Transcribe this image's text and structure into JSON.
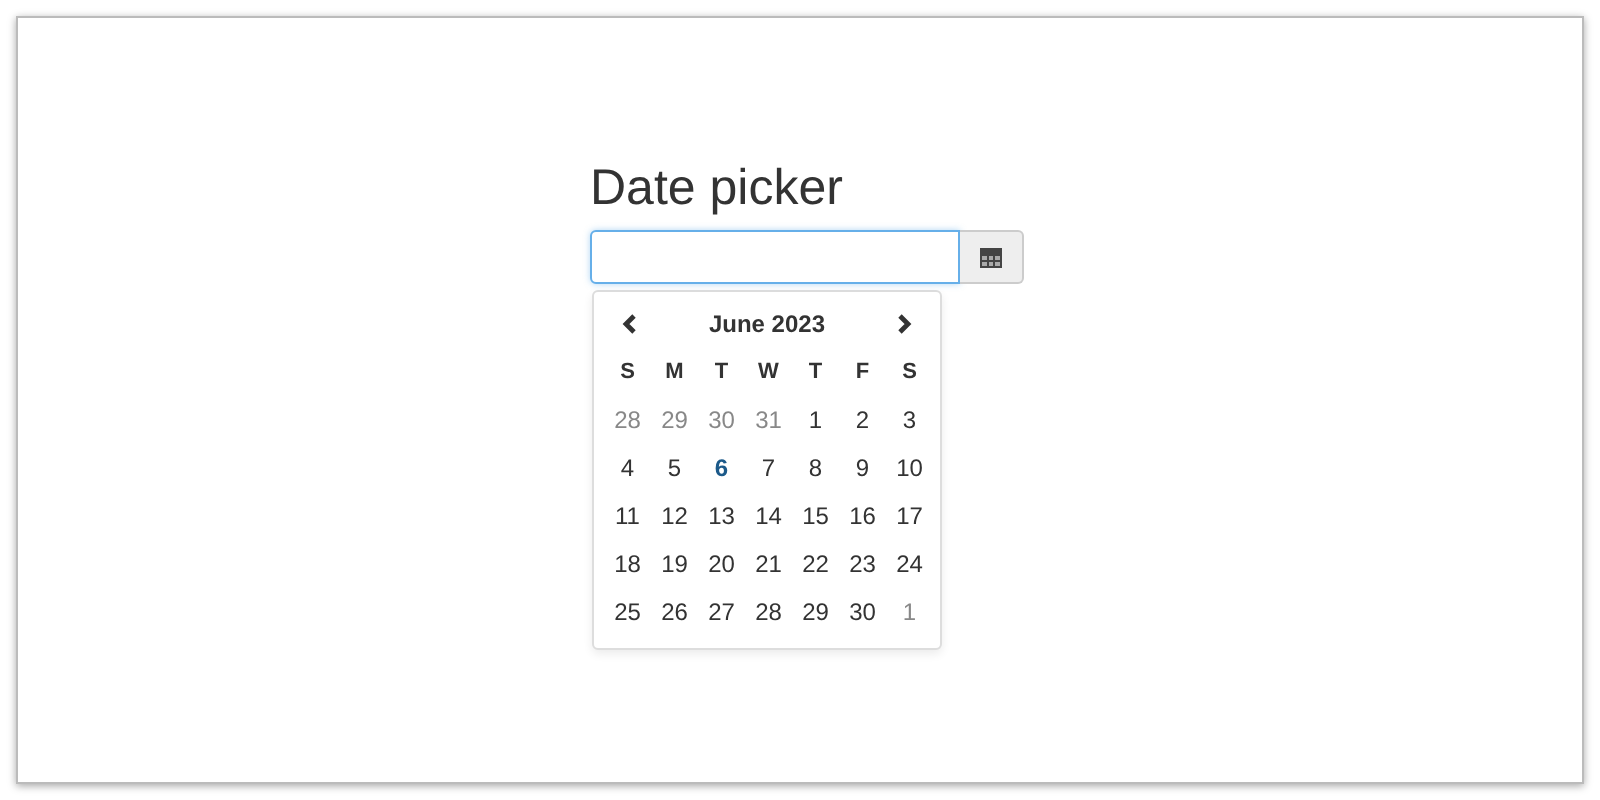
{
  "title": "Date picker",
  "input": {
    "focused": true
  },
  "calendar": {
    "month_label": "June 2023",
    "weekdays": [
      "S",
      "M",
      "T",
      "W",
      "T",
      "F",
      "S"
    ],
    "weeks": [
      [
        {
          "day": "28",
          "other_month": true,
          "today": false
        },
        {
          "day": "29",
          "other_month": true,
          "today": false
        },
        {
          "day": "30",
          "other_month": true,
          "today": false
        },
        {
          "day": "31",
          "other_month": true,
          "today": false
        },
        {
          "day": "1",
          "other_month": false,
          "today": false
        },
        {
          "day": "2",
          "other_month": false,
          "today": false
        },
        {
          "day": "3",
          "other_month": false,
          "today": false
        }
      ],
      [
        {
          "day": "4",
          "other_month": false,
          "today": false
        },
        {
          "day": "5",
          "other_month": false,
          "today": false
        },
        {
          "day": "6",
          "other_month": false,
          "today": true
        },
        {
          "day": "7",
          "other_month": false,
          "today": false
        },
        {
          "day": "8",
          "other_month": false,
          "today": false
        },
        {
          "day": "9",
          "other_month": false,
          "today": false
        },
        {
          "day": "10",
          "other_month": false,
          "today": false
        }
      ],
      [
        {
          "day": "11",
          "other_month": false,
          "today": false
        },
        {
          "day": "12",
          "other_month": false,
          "today": false
        },
        {
          "day": "13",
          "other_month": false,
          "today": false
        },
        {
          "day": "14",
          "other_month": false,
          "today": false
        },
        {
          "day": "15",
          "other_month": false,
          "today": false
        },
        {
          "day": "16",
          "other_month": false,
          "today": false
        },
        {
          "day": "17",
          "other_month": false,
          "today": false
        }
      ],
      [
        {
          "day": "18",
          "other_month": false,
          "today": false
        },
        {
          "day": "19",
          "other_month": false,
          "today": false
        },
        {
          "day": "20",
          "other_month": false,
          "today": false
        },
        {
          "day": "21",
          "other_month": false,
          "today": false
        },
        {
          "day": "22",
          "other_month": false,
          "today": false
        },
        {
          "day": "23",
          "other_month": false,
          "today": false
        },
        {
          "day": "24",
          "other_month": false,
          "today": false
        }
      ],
      [
        {
          "day": "25",
          "other_month": false,
          "today": false
        },
        {
          "day": "26",
          "other_month": false,
          "today": false
        },
        {
          "day": "27",
          "other_month": false,
          "today": false
        },
        {
          "day": "28",
          "other_month": false,
          "today": false
        },
        {
          "day": "29",
          "other_month": false,
          "today": false
        },
        {
          "day": "30",
          "other_month": false,
          "today": false
        },
        {
          "day": "1",
          "other_month": true,
          "today": false
        }
      ]
    ]
  }
}
